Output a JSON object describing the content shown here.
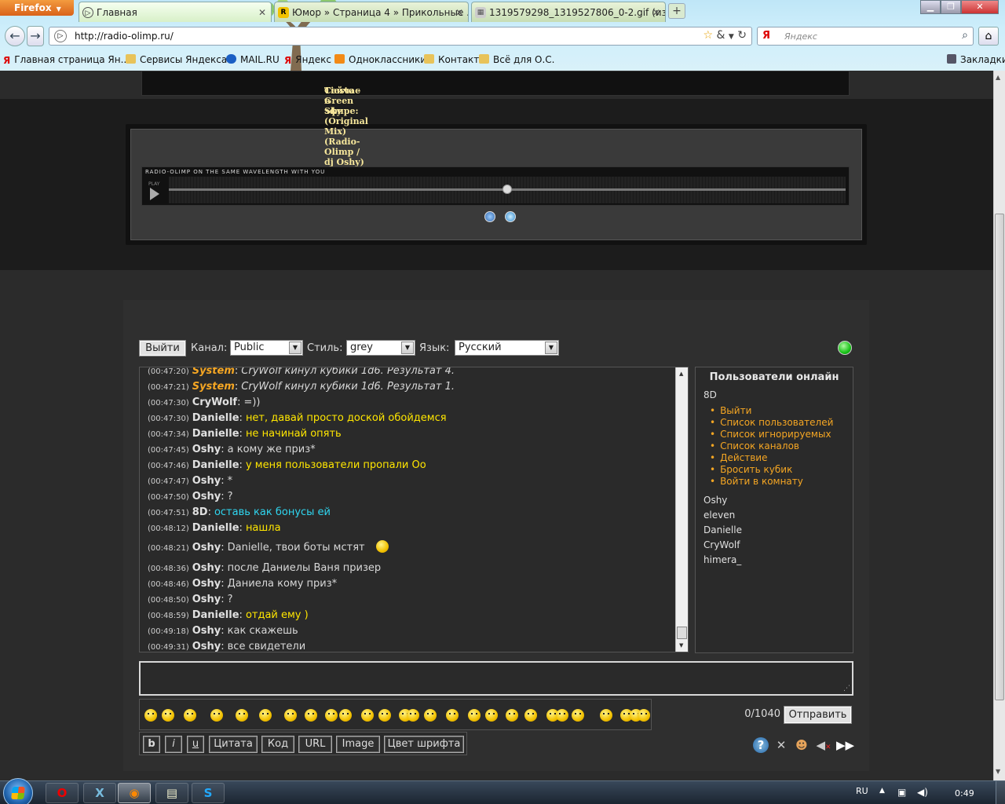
{
  "browser": {
    "app_button": "Firefox",
    "tabs": [
      {
        "label": "Главная",
        "active": true
      },
      {
        "label": "Юмор » Страница 4 » Прикольные ...",
        "active": false
      },
      {
        "label": "1319579298_1319527806_0-2.gif (из...",
        "active": false
      }
    ],
    "url": "http://radio-olimp.ru/",
    "search_placeholder": "Яндекс",
    "bookmarks": [
      "Главная страница Ян...",
      "Сервисы Яндекса",
      "MAIL.RU",
      "Яндекс",
      "Одноклассники",
      "Контакт",
      "Всё для О.С."
    ],
    "bookmarks_menu": "Закладки"
  },
  "player": {
    "on_air_label": "Сейчас в эфире:",
    "on_air_track": "Tiesto - Green Sky (Original Mix)  (Radio-Olimp / dj Oshy)",
    "brand": "RADIO-OLIMP ON THE SAME WAVELENGTH WITH YOU",
    "play_label": "PLAY",
    "progress": 0.5
  },
  "chat": {
    "exit_button": "Выйти",
    "channel_label": "Канал:",
    "channel_value": "Public",
    "style_label": "Стиль:",
    "style_value": "grey",
    "lang_label": "Язык:",
    "lang_value": "Русский",
    "messages": [
      {
        "time": "(00:47:20)",
        "nick": "System",
        "text": "CryWolf кинул кубики 1d6. Результат 4.",
        "kind": "system"
      },
      {
        "time": "(00:47:21)",
        "nick": "System",
        "text": "CryWolf кинул кубики 1d6. Результат 1.",
        "kind": "system"
      },
      {
        "time": "(00:47:30)",
        "nick": "CryWolf",
        "text": "=))",
        "kind": "grey"
      },
      {
        "time": "(00:47:30)",
        "nick": "Danielle",
        "text": "нет, давай просто доской обойдемся",
        "kind": "yellow"
      },
      {
        "time": "(00:47:34)",
        "nick": "Danielle",
        "text": "не начинай опять",
        "kind": "yellow"
      },
      {
        "time": "(00:47:45)",
        "nick": "Oshy",
        "text": "а кому же приз*",
        "kind": "grey"
      },
      {
        "time": "(00:47:46)",
        "nick": "Danielle",
        "text": "у меня пользователи пропали Оо",
        "kind": "yellow"
      },
      {
        "time": "(00:47:47)",
        "nick": "Oshy",
        "text": "*",
        "kind": "grey"
      },
      {
        "time": "(00:47:50)",
        "nick": "Oshy",
        "text": "?",
        "kind": "grey"
      },
      {
        "time": "(00:47:51)",
        "nick": "8D",
        "text": "оставь как бонусы ей",
        "kind": "cyan"
      },
      {
        "time": "(00:48:12)",
        "nick": "Danielle",
        "text": "нашла",
        "kind": "yellow"
      },
      {
        "time": "(00:48:21)",
        "nick": "Oshy",
        "text": "Danielle, твои боты мстят",
        "kind": "grey",
        "smile": true
      },
      {
        "time": "(00:48:36)",
        "nick": "Oshy",
        "text": "после Даниелы Ваня призер",
        "kind": "grey"
      },
      {
        "time": "(00:48:46)",
        "nick": "Oshy",
        "text": "Даниела кому приз*",
        "kind": "grey"
      },
      {
        "time": "(00:48:50)",
        "nick": "Oshy",
        "text": "?",
        "kind": "grey"
      },
      {
        "time": "(00:48:59)",
        "nick": "Danielle",
        "text": "отдай ему )",
        "kind": "yellow"
      },
      {
        "time": "(00:49:18)",
        "nick": "Oshy",
        "text": "как скажешь",
        "kind": "grey"
      },
      {
        "time": "(00:49:31)",
        "nick": "Oshy",
        "text": "все свидетели",
        "kind": "grey"
      }
    ],
    "colors": {
      "system": "#f5a623",
      "yellow": "#ffe600",
      "cyan": "#2fd6f0",
      "grey": "#d8d8d8",
      "link": "#f5a623"
    },
    "users_title": "Пользователи онлайн",
    "current_user": "8D",
    "user_menu": [
      "Выйти",
      "Список пользователей",
      "Список игнорируемых",
      "Список каналов",
      "Действие",
      "Бросить кубик",
      "Войти в комнату"
    ],
    "online_users": [
      "Oshy",
      "eleven",
      "Danielle",
      "CryWolf",
      "himera_"
    ],
    "counter": "0/1040",
    "send_button": "Отправить",
    "format_buttons": [
      "b",
      "i",
      "u",
      "Цитата",
      "Код",
      "URL",
      "Image",
      "Цвет шрифта"
    ],
    "tool_icons": [
      "help-icon",
      "settings-icon",
      "users-icon",
      "sound-off-icon",
      "forward-icon"
    ]
  },
  "taskbar": {
    "lang": "RU",
    "time": "0:49"
  }
}
